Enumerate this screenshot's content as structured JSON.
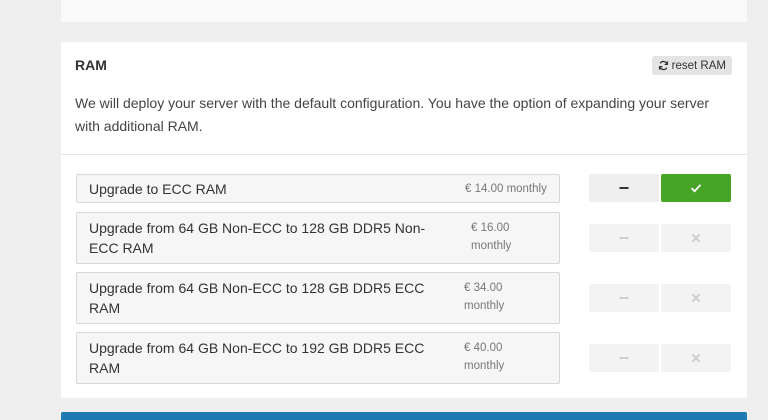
{
  "previous_section": {
    "text": "...p...y...y...[]"
  },
  "ram": {
    "title": "RAM",
    "reset_label": "reset RAM",
    "description": "We will deploy your server with the default configuration. You have the option of expanding your server with additional RAM.",
    "options": [
      {
        "label": "Upgrade to ECC RAM",
        "price": "€ 14.00 monthly",
        "selected": true
      },
      {
        "label": "Upgrade from 64 GB Non-ECC to 128 GB DDR5 Non-ECC RAM",
        "price": "€ 16.00 monthly",
        "selected": false
      },
      {
        "label": "Upgrade from 64 GB Non-ECC to 128 GB DDR5 ECC RAM",
        "price": "€ 34.00 monthly",
        "selected": false
      },
      {
        "label": "Upgrade from 64 GB Non-ECC to 192 GB DDR5 ECC RAM",
        "price": "€ 40.00 monthly",
        "selected": false
      }
    ]
  },
  "colors": {
    "accent_green": "#47a426",
    "bottom_bar": "#1f7ab3"
  },
  "icons": {
    "reset": "refresh-icon",
    "remove": "minus-icon",
    "add": "check-icon",
    "close": "close-icon"
  }
}
